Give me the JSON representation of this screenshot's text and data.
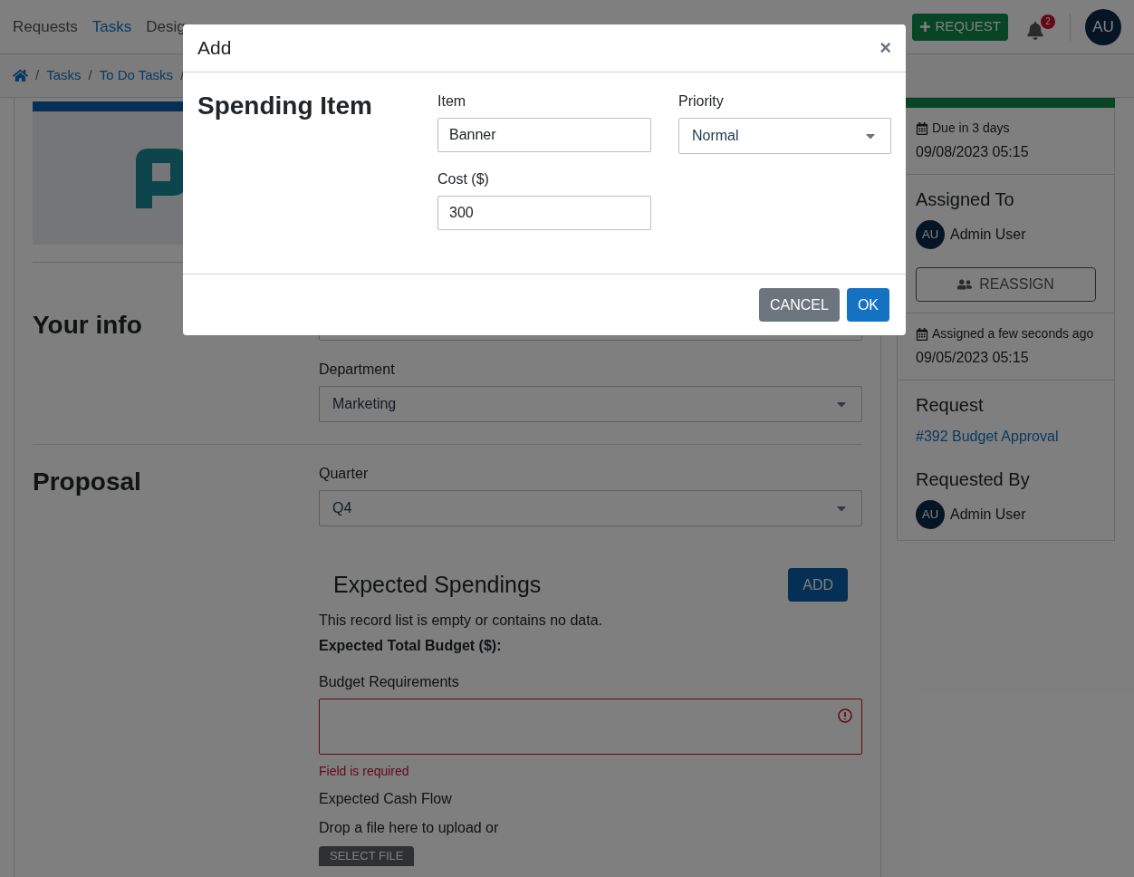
{
  "nav": {
    "items": [
      {
        "label": "Requests",
        "selected": false
      },
      {
        "label": "Tasks",
        "selected": true
      },
      {
        "label": "Desig",
        "selected": false
      }
    ],
    "request_button": "REQUEST",
    "notification_count": "2",
    "avatar": "AU"
  },
  "breadcrumb": {
    "separator": "/",
    "items": [
      "Tasks",
      "To Do Tasks"
    ]
  },
  "sections": [
    {
      "title": "Your info",
      "fields": [
        {
          "kind": "input"
        },
        {
          "kind": "select",
          "label": "Department",
          "value": "Marketing"
        }
      ]
    },
    {
      "title": "Proposal",
      "fields": [
        {
          "kind": "select",
          "label": "Quarter",
          "value": "Q4"
        }
      ]
    }
  ],
  "spendings": {
    "title": "Expected Spendings",
    "add_button": "ADD",
    "empty_message": "This record list is empty or contains no data.",
    "total_label": "Expected Total Budget ($):"
  },
  "budget_requirements": {
    "label": "Budget Requirements",
    "invalid": true,
    "error": "Field is required"
  },
  "cash_flow": {
    "label": "Expected Cash Flow",
    "drop_text": "Drop a file here to upload or",
    "button": "SELECT FILE"
  },
  "sidebar": {
    "due": {
      "text": "Due in 3 days",
      "date": "09/08/2023 05:15"
    },
    "assigned_to": {
      "title": "Assigned To",
      "avatar": "AU",
      "name": "Admin User",
      "button": "REASSIGN"
    },
    "assigned": {
      "text": "Assigned a few seconds ago",
      "date": "09/05/2023 05:15"
    },
    "request": {
      "title": "Request",
      "link": "#392 Budget Approval"
    },
    "requested_by": {
      "title": "Requested By",
      "avatar": "AU",
      "name": "Admin User"
    }
  },
  "modal": {
    "title": "Add",
    "close": "×",
    "heading": "Spending Item",
    "fields": [
      {
        "kind": "input",
        "label": "Item",
        "value": "Banner"
      },
      {
        "kind": "select",
        "label": "Priority",
        "value": "Normal"
      },
      {
        "kind": "input",
        "label": "Cost ($)",
        "value": "300"
      }
    ],
    "buttons": [
      {
        "label": "CANCEL",
        "kind": "secondary"
      },
      {
        "label": "OK",
        "kind": "primary"
      }
    ]
  }
}
